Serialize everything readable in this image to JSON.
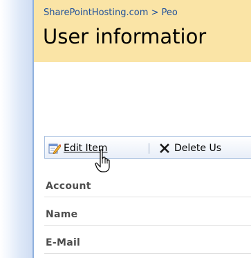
{
  "breadcrumb": "SharePointHosting.com > Peo",
  "page_title": "User informatior",
  "toolbar": {
    "edit_label": "Edit Item",
    "separator": "|",
    "delete_label": "Delete Us"
  },
  "fields": [
    {
      "label": "Account"
    },
    {
      "label": "Name"
    },
    {
      "label": "E-Mail"
    }
  ],
  "colors": {
    "title_band": "#fae4a6",
    "link_blue": "#1e4f9a",
    "toolbar_border": "#a7bfdf"
  },
  "icons": {
    "edit": "edit-item-icon",
    "delete": "delete-x-icon",
    "cursor": "hand-pointer-icon"
  }
}
